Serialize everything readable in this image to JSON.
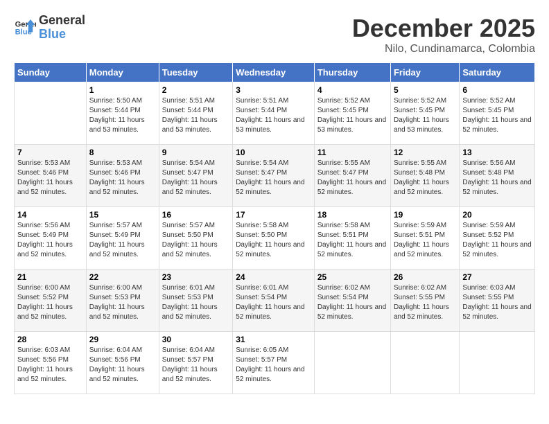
{
  "logo": {
    "line1": "General",
    "line2": "Blue"
  },
  "title": "December 2025",
  "location": "Nilo, Cundinamarca, Colombia",
  "days_of_week": [
    "Sunday",
    "Monday",
    "Tuesday",
    "Wednesday",
    "Thursday",
    "Friday",
    "Saturday"
  ],
  "weeks": [
    [
      {
        "day": "",
        "sunrise": "",
        "sunset": "",
        "daylight": ""
      },
      {
        "day": "1",
        "sunrise": "Sunrise: 5:50 AM",
        "sunset": "Sunset: 5:44 PM",
        "daylight": "Daylight: 11 hours and 53 minutes."
      },
      {
        "day": "2",
        "sunrise": "Sunrise: 5:51 AM",
        "sunset": "Sunset: 5:44 PM",
        "daylight": "Daylight: 11 hours and 53 minutes."
      },
      {
        "day": "3",
        "sunrise": "Sunrise: 5:51 AM",
        "sunset": "Sunset: 5:44 PM",
        "daylight": "Daylight: 11 hours and 53 minutes."
      },
      {
        "day": "4",
        "sunrise": "Sunrise: 5:52 AM",
        "sunset": "Sunset: 5:45 PM",
        "daylight": "Daylight: 11 hours and 53 minutes."
      },
      {
        "day": "5",
        "sunrise": "Sunrise: 5:52 AM",
        "sunset": "Sunset: 5:45 PM",
        "daylight": "Daylight: 11 hours and 53 minutes."
      },
      {
        "day": "6",
        "sunrise": "Sunrise: 5:52 AM",
        "sunset": "Sunset: 5:45 PM",
        "daylight": "Daylight: 11 hours and 52 minutes."
      }
    ],
    [
      {
        "day": "7",
        "sunrise": "Sunrise: 5:53 AM",
        "sunset": "Sunset: 5:46 PM",
        "daylight": "Daylight: 11 hours and 52 minutes."
      },
      {
        "day": "8",
        "sunrise": "Sunrise: 5:53 AM",
        "sunset": "Sunset: 5:46 PM",
        "daylight": "Daylight: 11 hours and 52 minutes."
      },
      {
        "day": "9",
        "sunrise": "Sunrise: 5:54 AM",
        "sunset": "Sunset: 5:47 PM",
        "daylight": "Daylight: 11 hours and 52 minutes."
      },
      {
        "day": "10",
        "sunrise": "Sunrise: 5:54 AM",
        "sunset": "Sunset: 5:47 PM",
        "daylight": "Daylight: 11 hours and 52 minutes."
      },
      {
        "day": "11",
        "sunrise": "Sunrise: 5:55 AM",
        "sunset": "Sunset: 5:47 PM",
        "daylight": "Daylight: 11 hours and 52 minutes."
      },
      {
        "day": "12",
        "sunrise": "Sunrise: 5:55 AM",
        "sunset": "Sunset: 5:48 PM",
        "daylight": "Daylight: 11 hours and 52 minutes."
      },
      {
        "day": "13",
        "sunrise": "Sunrise: 5:56 AM",
        "sunset": "Sunset: 5:48 PM",
        "daylight": "Daylight: 11 hours and 52 minutes."
      }
    ],
    [
      {
        "day": "14",
        "sunrise": "Sunrise: 5:56 AM",
        "sunset": "Sunset: 5:49 PM",
        "daylight": "Daylight: 11 hours and 52 minutes."
      },
      {
        "day": "15",
        "sunrise": "Sunrise: 5:57 AM",
        "sunset": "Sunset: 5:49 PM",
        "daylight": "Daylight: 11 hours and 52 minutes."
      },
      {
        "day": "16",
        "sunrise": "Sunrise: 5:57 AM",
        "sunset": "Sunset: 5:50 PM",
        "daylight": "Daylight: 11 hours and 52 minutes."
      },
      {
        "day": "17",
        "sunrise": "Sunrise: 5:58 AM",
        "sunset": "Sunset: 5:50 PM",
        "daylight": "Daylight: 11 hours and 52 minutes."
      },
      {
        "day": "18",
        "sunrise": "Sunrise: 5:58 AM",
        "sunset": "Sunset: 5:51 PM",
        "daylight": "Daylight: 11 hours and 52 minutes."
      },
      {
        "day": "19",
        "sunrise": "Sunrise: 5:59 AM",
        "sunset": "Sunset: 5:51 PM",
        "daylight": "Daylight: 11 hours and 52 minutes."
      },
      {
        "day": "20",
        "sunrise": "Sunrise: 5:59 AM",
        "sunset": "Sunset: 5:52 PM",
        "daylight": "Daylight: 11 hours and 52 minutes."
      }
    ],
    [
      {
        "day": "21",
        "sunrise": "Sunrise: 6:00 AM",
        "sunset": "Sunset: 5:52 PM",
        "daylight": "Daylight: 11 hours and 52 minutes."
      },
      {
        "day": "22",
        "sunrise": "Sunrise: 6:00 AM",
        "sunset": "Sunset: 5:53 PM",
        "daylight": "Daylight: 11 hours and 52 minutes."
      },
      {
        "day": "23",
        "sunrise": "Sunrise: 6:01 AM",
        "sunset": "Sunset: 5:53 PM",
        "daylight": "Daylight: 11 hours and 52 minutes."
      },
      {
        "day": "24",
        "sunrise": "Sunrise: 6:01 AM",
        "sunset": "Sunset: 5:54 PM",
        "daylight": "Daylight: 11 hours and 52 minutes."
      },
      {
        "day": "25",
        "sunrise": "Sunrise: 6:02 AM",
        "sunset": "Sunset: 5:54 PM",
        "daylight": "Daylight: 11 hours and 52 minutes."
      },
      {
        "day": "26",
        "sunrise": "Sunrise: 6:02 AM",
        "sunset": "Sunset: 5:55 PM",
        "daylight": "Daylight: 11 hours and 52 minutes."
      },
      {
        "day": "27",
        "sunrise": "Sunrise: 6:03 AM",
        "sunset": "Sunset: 5:55 PM",
        "daylight": "Daylight: 11 hours and 52 minutes."
      }
    ],
    [
      {
        "day": "28",
        "sunrise": "Sunrise: 6:03 AM",
        "sunset": "Sunset: 5:56 PM",
        "daylight": "Daylight: 11 hours and 52 minutes."
      },
      {
        "day": "29",
        "sunrise": "Sunrise: 6:04 AM",
        "sunset": "Sunset: 5:56 PM",
        "daylight": "Daylight: 11 hours and 52 minutes."
      },
      {
        "day": "30",
        "sunrise": "Sunrise: 6:04 AM",
        "sunset": "Sunset: 5:57 PM",
        "daylight": "Daylight: 11 hours and 52 minutes."
      },
      {
        "day": "31",
        "sunrise": "Sunrise: 6:05 AM",
        "sunset": "Sunset: 5:57 PM",
        "daylight": "Daylight: 11 hours and 52 minutes."
      },
      {
        "day": "",
        "sunrise": "",
        "sunset": "",
        "daylight": ""
      },
      {
        "day": "",
        "sunrise": "",
        "sunset": "",
        "daylight": ""
      },
      {
        "day": "",
        "sunrise": "",
        "sunset": "",
        "daylight": ""
      }
    ]
  ]
}
